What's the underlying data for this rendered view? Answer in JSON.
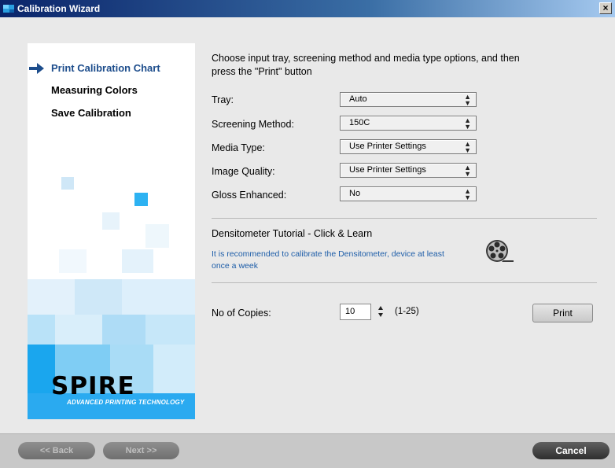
{
  "window": {
    "title": "Calibration Wizard",
    "close_glyph": "×"
  },
  "sidebar": {
    "steps": [
      {
        "label": "Print Calibration Chart",
        "active": true
      },
      {
        "label": "Measuring Colors",
        "active": false
      },
      {
        "label": "Save Calibration",
        "active": false
      }
    ],
    "logo_text": "SPIRE",
    "logo_tagline": "ADVANCED PRINTING TECHNOLOGY"
  },
  "main": {
    "instruction": "Choose input tray, screening method and media type options, and then press the \"Print\" button",
    "fields": [
      {
        "label": "Tray:",
        "value": "Auto"
      },
      {
        "label": "Screening Method:",
        "value": "150C"
      },
      {
        "label": "Media Type:",
        "value": "Use Printer Settings"
      },
      {
        "label": "Image Quality:",
        "value": "Use Printer Settings"
      },
      {
        "label": "Gloss Enhanced:",
        "value": "No"
      }
    ],
    "tutorial": {
      "title": "Densitometer Tutorial - Click & Learn",
      "text": "It is recommended to calibrate the Densitometer, device at least once a week",
      "icon": "film-reel-icon"
    },
    "copies": {
      "label": "No of Copies:",
      "value": "10",
      "range": "(1-25)"
    },
    "print_label": "Print"
  },
  "footer": {
    "back_label": "<< Back",
    "next_label": "Next >>",
    "cancel_label": "Cancel"
  },
  "colors": {
    "accent": "#1d4d8c",
    "link": "#1d5da8",
    "tile_blue": "#1eaaf0",
    "footer_bg": "#c8c8c8"
  }
}
